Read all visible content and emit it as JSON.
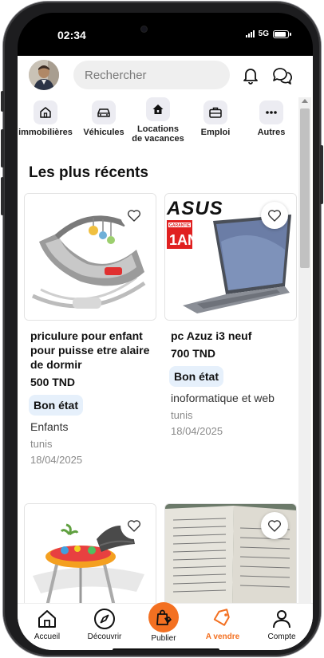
{
  "status": {
    "time": "02:34",
    "network": "5G",
    "battery_level": 0.85
  },
  "search": {
    "placeholder": "Rechercher"
  },
  "categories": [
    {
      "label": "immobilières",
      "icon": "home-icon"
    },
    {
      "label": "Véhicules",
      "icon": "car-icon"
    },
    {
      "label": "Locations de vacances",
      "line1": "Locations",
      "line2": "de vacances",
      "icon": "house-rent-icon"
    },
    {
      "label": "Emploi",
      "icon": "briefcase-icon"
    },
    {
      "label": "Autres",
      "icon": "more-icon"
    }
  ],
  "section_title": "Les plus récents",
  "listings": [
    {
      "title": "priculure pour enfant pour puisse etre alaire de dormir",
      "price": "500 TND",
      "condition": "Bon état",
      "category": "Enfants",
      "location": "tunis",
      "date": "18/04/2025"
    },
    {
      "title": "pc Azuz i3 neuf",
      "price": "700 TND",
      "condition": "Bon état",
      "category": "inoformatique et web",
      "location": "tunis",
      "date": "18/04/2025",
      "image_brand": "ASUS",
      "image_badge_top": "GARANTIE",
      "image_badge_main": "1AN"
    },
    {},
    {}
  ],
  "bottom_nav": [
    {
      "label": "Accueil",
      "icon": "home-outline-icon"
    },
    {
      "label": "Découvrir",
      "icon": "compass-icon"
    },
    {
      "label": "Publier",
      "icon": "bag-tag-icon"
    },
    {
      "label": "A vendre",
      "icon": "tag-icon",
      "active": true
    },
    {
      "label": "Compte",
      "icon": "person-icon"
    }
  ],
  "colors": {
    "accent": "#f37021",
    "badge_bg": "#e6f0fb",
    "category_bg": "#ececf2",
    "search_bg": "#efefef"
  }
}
